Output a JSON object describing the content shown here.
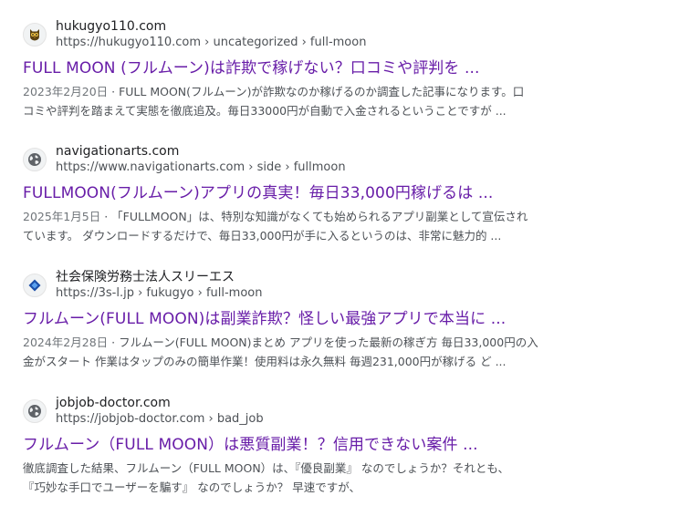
{
  "results": [
    {
      "site_name": "hukugyo110.com",
      "url": "https://hukugyo110.com › uncategorized › full-moon",
      "favicon": "owl-logo-icon",
      "title": "FULL MOON (フルムーン)は詐欺で稼げない？口コミや評判を ...",
      "date": "2023年2月20日",
      "snippet_line1": " · FULL MOON(フルムーン)が詐欺なのか稼げるのか調査した記事になります。口",
      "snippet_line2": "コミや評判を踏まえて実態を徹底追及。毎日33000円が自動で入金されるということですが ..."
    },
    {
      "site_name": "navigationarts.com",
      "url": "https://www.navigationarts.com › side › fullmoon",
      "favicon": "globe-icon",
      "title": "FULLMOON(フルムーン)アプリの真実！毎日33,000円稼げるは ...",
      "date": "2025年1月5日",
      "snippet_line1": " · 「FULLMOON」は、特別な知識がなくても始められるアプリ副業として宣伝され",
      "snippet_line2": "ています。 ダウンロードするだけで、毎日33,000円が手に入るというのは、非常に魅力的 ..."
    },
    {
      "site_name": "社会保険労務士法人スリーエス",
      "url": "https://3s-l.jp › fukugyo › full-moon",
      "favicon": "diamond-logo-icon",
      "title": "フルムーン(FULL MOON)は副業詐欺？怪しい最強アプリで本当に ...",
      "date": "2024年2月28日",
      "snippet_line1": " · フルムーン(FULL MOON)まとめ アプリを使った最新の稼ぎ方 毎日33,000円の入",
      "snippet_line2": "金がスタート 作業はタップのみの簡単作業！使用料は永久無料 毎週231,000円が稼げる ど ..."
    },
    {
      "site_name": "jobjob-doctor.com",
      "url": "https://jobjob-doctor.com › bad_job",
      "favicon": "globe-icon",
      "title": "フルムーン（FULL MOON）は悪質副業！？信用できない案件 ...",
      "date": "",
      "snippet_line1": "徹底調査した結果、フルムーン（FULL MOON）は、『優良副業』 なのでしょうか？それとも、",
      "snippet_line2": "『巧妙な手口でユーザーを騙す』 なのでしょうか？ 早速ですが、"
    }
  ],
  "colors": {
    "title_visited": "#681da8",
    "url": "#4d5156",
    "snippet": "#4d5156"
  }
}
